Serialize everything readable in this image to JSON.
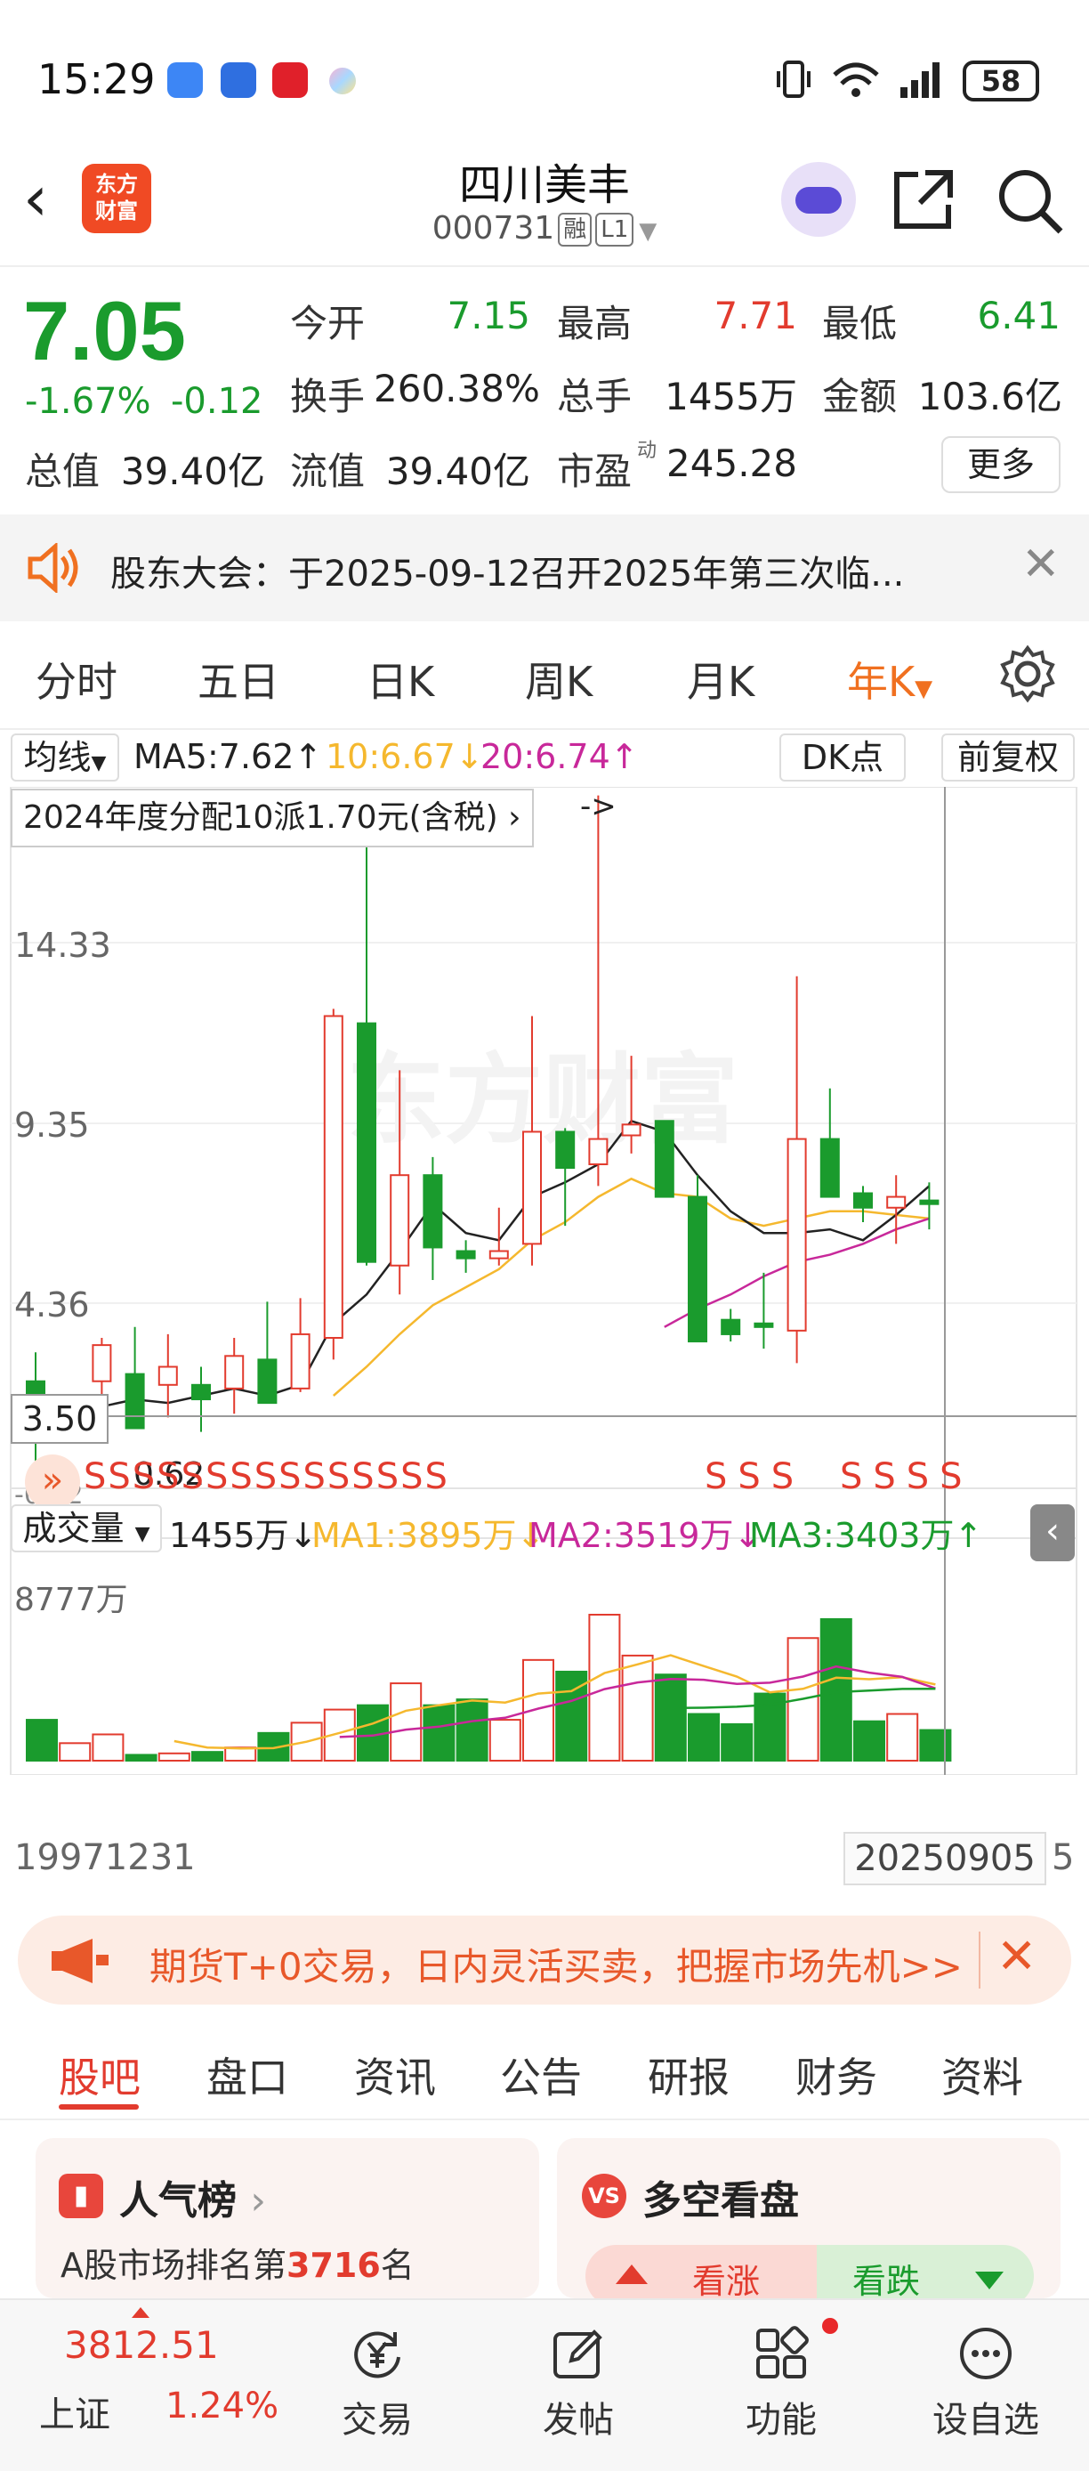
{
  "status_bar": {
    "time": "15:29",
    "battery": "58"
  },
  "header": {
    "title": "四川美丰",
    "code": "000731",
    "tag_margin": "融",
    "tag_level": "L1",
    "logo_text_line1": "东方",
    "logo_text_line2": "财富"
  },
  "quote": {
    "price": "7.05",
    "change_pct": "-1.67%",
    "change_amt": "-0.12",
    "open_label": "今开",
    "open": "7.15",
    "high_label": "最高",
    "high": "7.71",
    "low_label": "最低",
    "low": "6.41",
    "turnover_label": "换手",
    "turnover": "260.38%",
    "volume_label": "总手",
    "volume": "1455万",
    "amount_label": "金额",
    "amount": "103.6亿",
    "mcap_label": "总值",
    "mcap": "39.40亿",
    "float_label": "流值",
    "float_mcap": "39.40亿",
    "pe_label": "市盈",
    "pe_sup": "动",
    "pe": "245.28",
    "more_label": "更多"
  },
  "notice": {
    "text": "股东大会：于2025-09-12召开2025年第三次临..."
  },
  "kline_tabs": [
    {
      "label": "分时",
      "active": false
    },
    {
      "label": "五日",
      "active": false
    },
    {
      "label": "日K",
      "active": false
    },
    {
      "label": "周K",
      "active": false
    },
    {
      "label": "月K",
      "active": false
    },
    {
      "label": "年K",
      "active": true
    }
  ],
  "chart_controls": {
    "ma_selector": "均线",
    "ma5": "MA5:7.62↑",
    "ma10": "10:6.67↓",
    "ma20": "20:6.74↑",
    "dk_button": "DK点",
    "adjust_button": "前复权",
    "dividend_note": "2024年度分配10派1.70元(含税)",
    "arrow_text": "->",
    "price_axis": [
      "14.33",
      "9.35",
      "4.36"
    ],
    "crosshair_price": "3.50",
    "bottom_price": "-0.62",
    "low_tick": "0.62",
    "vol_selector": "成交量",
    "vol_value": "1455万↓",
    "vol_ma1": "MA1:3895万↓",
    "vol_ma2": "MA2:3519万↓",
    "vol_ma3": "MA3:3403万↑",
    "vol_axis_top": "8777万",
    "date_start": "19971231",
    "date_cursor": "20250905",
    "date_end_fragment": "5",
    "s_markers_left": "SSSSSSSSSSSSSSS",
    "s_markers_mid": "SSS",
    "s_markers_right": "SSSS"
  },
  "colors": {
    "up": "#e23b2e",
    "down": "#1a9b2d",
    "ma5": "#222222",
    "ma10": "#f5b82e",
    "ma20": "#c8289a",
    "accent": "#f07020"
  },
  "chart_data": {
    "type": "candlestick",
    "x_start": "1997",
    "x_end": "2025",
    "candles": [
      {
        "o": 2.2,
        "h": 3.0,
        "l": -0.6,
        "c": 1.6
      },
      {
        "o": 0.8,
        "h": 1.3,
        "l": 0.5,
        "c": 1.0
      },
      {
        "o": 2.2,
        "h": 3.4,
        "l": 0.9,
        "c": 3.2
      },
      {
        "o": 2.4,
        "h": 3.7,
        "l": 1.6,
        "c": 0.9
      },
      {
        "o": 2.1,
        "h": 3.5,
        "l": 1.2,
        "c": 2.6
      },
      {
        "o": 2.1,
        "h": 2.6,
        "l": 0.8,
        "c": 1.7
      },
      {
        "o": 2.0,
        "h": 3.4,
        "l": 1.3,
        "c": 2.9
      },
      {
        "o": 2.8,
        "h": 4.4,
        "l": 1.9,
        "c": 1.6
      },
      {
        "o": 2.0,
        "h": 4.5,
        "l": 1.9,
        "c": 3.5
      },
      {
        "o": 3.4,
        "h": 12.5,
        "l": 2.8,
        "c": 12.3
      },
      {
        "o": 12.1,
        "h": 17.0,
        "l": 5.4,
        "c": 5.5
      },
      {
        "o": 5.4,
        "h": 10.8,
        "l": 4.6,
        "c": 7.9
      },
      {
        "o": 7.9,
        "h": 8.4,
        "l": 5.0,
        "c": 5.9
      },
      {
        "o": 5.8,
        "h": 6.1,
        "l": 5.2,
        "c": 5.6
      },
      {
        "o": 5.6,
        "h": 7.0,
        "l": 5.4,
        "c": 5.8
      },
      {
        "o": 6.0,
        "h": 12.3,
        "l": 5.4,
        "c": 9.1
      },
      {
        "o": 9.1,
        "h": 9.2,
        "l": 6.5,
        "c": 8.1
      },
      {
        "o": 8.2,
        "h": 18.4,
        "l": 7.6,
        "c": 8.9
      },
      {
        "o": 9.0,
        "h": 11.2,
        "l": 8.5,
        "c": 9.3
      },
      {
        "o": 9.4,
        "h": 9.4,
        "l": 7.7,
        "c": 7.3
      },
      {
        "o": 7.3,
        "h": 7.9,
        "l": 3.5,
        "c": 3.3
      },
      {
        "o": 3.9,
        "h": 4.2,
        "l": 3.3,
        "c": 3.5
      },
      {
        "o": 3.8,
        "h": 5.2,
        "l": 3.1,
        "c": 3.7
      },
      {
        "o": 3.6,
        "h": 13.4,
        "l": 2.7,
        "c": 8.9
      },
      {
        "o": 8.9,
        "h": 10.3,
        "l": 7.6,
        "c": 7.3
      },
      {
        "o": 7.4,
        "h": 7.6,
        "l": 6.6,
        "c": 7.0
      },
      {
        "o": 7.0,
        "h": 7.9,
        "l": 6.0,
        "c": 7.3
      },
      {
        "o": 7.2,
        "h": 7.7,
        "l": 6.4,
        "c": 7.1
      }
    ],
    "ma5": [
      1.4,
      1.3,
      1.5,
      1.7,
      1.6,
      1.8,
      2.0,
      1.8,
      2.1,
      3.8,
      4.6,
      5.8,
      7.1,
      6.3,
      6.1,
      7.3,
      7.7,
      8.2,
      9.4,
      9.1,
      7.9,
      6.9,
      6.3,
      6.3,
      6.4,
      6.1,
      6.8,
      7.6
    ],
    "ma10": [
      null,
      null,
      null,
      null,
      null,
      null,
      null,
      null,
      null,
      1.8,
      2.6,
      3.5,
      4.3,
      4.8,
      5.3,
      6.1,
      6.6,
      7.3,
      7.8,
      7.4,
      7.3,
      6.7,
      6.5,
      6.7,
      6.9,
      6.9,
      6.8,
      6.7
    ],
    "ma20": [
      null,
      null,
      null,
      null,
      null,
      null,
      null,
      null,
      null,
      null,
      null,
      null,
      null,
      null,
      null,
      null,
      null,
      null,
      null,
      3.7,
      4.2,
      4.6,
      5.1,
      5.5,
      5.7,
      6.0,
      6.4,
      6.7
    ],
    "volume": [
      0.28,
      0.12,
      0.18,
      0.04,
      0.05,
      0.06,
      0.09,
      0.19,
      0.26,
      0.35,
      0.38,
      0.53,
      0.38,
      0.42,
      0.28,
      0.69,
      0.61,
      1.0,
      0.72,
      0.59,
      0.32,
      0.25,
      0.46,
      0.84,
      0.97,
      0.27,
      0.32,
      0.21
    ],
    "vol_max_label": "8777万"
  },
  "banner": {
    "text": "期货T+0交易，日内灵活买卖，把握市场先机>>"
  },
  "bottom_tabs": [
    {
      "label": "股吧",
      "active": true
    },
    {
      "label": "盘口",
      "active": false
    },
    {
      "label": "资讯",
      "active": false
    },
    {
      "label": "公告",
      "active": false
    },
    {
      "label": "研报",
      "active": false
    },
    {
      "label": "财务",
      "active": false
    },
    {
      "label": "资料",
      "active": false
    }
  ],
  "cards": {
    "popularity_title": "人气榜",
    "popularity_prefix": "A股市场排名第",
    "popularity_rank": "3716",
    "popularity_suffix": "名",
    "sentiment_title": "多空看盘",
    "bull_label": "看涨",
    "bear_label": "看跌"
  },
  "bottom_nav": {
    "index_value": "3812.51",
    "index_name": "上证",
    "index_change": "1.24%",
    "trade": "交易",
    "post": "发帖",
    "function": "功能",
    "settings": "设自选"
  }
}
